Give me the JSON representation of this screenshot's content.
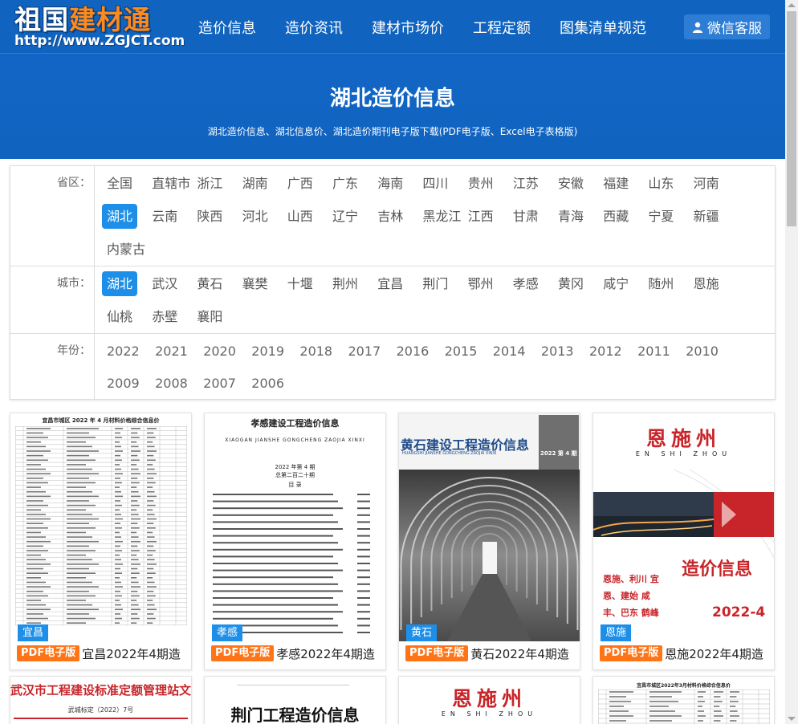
{
  "logo": {
    "text_white": "祖国",
    "text_orange": "建材通",
    "url": "http://www.ZGJCT.com"
  },
  "nav": {
    "items": [
      "造价信息",
      "造价资讯",
      "建材市场价",
      "工程定额",
      "图集清单规范"
    ],
    "wechat": "微信客服"
  },
  "hero": {
    "title": "湖北造价信息",
    "subtitle": "湖北造价信息、湖北信息价、湖北造价期刊电子版下载(PDF电子版、Excel电子表格版)"
  },
  "filter": {
    "province_label": "省区：",
    "provinces": [
      "全国",
      "直辖市",
      "浙江",
      "湖南",
      "广西",
      "广东",
      "海南",
      "四川",
      "贵州",
      "江苏",
      "安徽",
      "福建",
      "山东",
      "河南",
      "湖北",
      "云南",
      "陕西",
      "河北",
      "山西",
      "辽宁",
      "吉林",
      "黑龙江",
      "江西",
      "甘肃",
      "青海",
      "西藏",
      "宁夏",
      "新疆",
      "内蒙古"
    ],
    "province_active": "湖北",
    "city_label": "城市：",
    "cities": [
      "湖北",
      "武汉",
      "黄石",
      "襄樊",
      "十堰",
      "荆州",
      "宜昌",
      "荆门",
      "鄂州",
      "孝感",
      "黄冈",
      "咸宁",
      "随州",
      "恩施",
      "仙桃",
      "赤壁",
      "襄阳"
    ],
    "city_active": "湖北",
    "year_label": "年份：",
    "years": [
      "2022",
      "2021",
      "2020",
      "2019",
      "2018",
      "2017",
      "2016",
      "2015",
      "2014",
      "2013",
      "2012",
      "2011",
      "2010",
      "2009",
      "2008",
      "2007",
      "2006"
    ]
  },
  "cards": [
    {
      "city": "宜昌",
      "badge": "PDF电子版",
      "title": "宜昌2022年4期造",
      "doc_header": "宜昌市城区 2022 年 4 月材料价格综合信息价"
    },
    {
      "city": "孝感",
      "badge": "PDF电子版",
      "title": "孝感2022年4期造",
      "doc_header": "孝感建设工程造价信息",
      "doc_pinyin": "XIAOGAN JIANSHE GONGCHENG ZAOJIA XINXI",
      "doc_issue": "2022 年第 4 期",
      "doc_total": "总第二百二十期",
      "doc_toc": "目 录"
    },
    {
      "city": "黄石",
      "badge": "PDF电子版",
      "title": "黄石2022年4期造",
      "doc_header": "黄石建设工程造价信息",
      "doc_pinyin": "HUANGSHI JIANSHE GONGCHENG ZAOJIA XINXI",
      "doc_issue": "2022 第 4 期"
    },
    {
      "city": "恩施",
      "badge": "PDF电子版",
      "title": "恩施2022年4期造",
      "doc_header": "恩施州",
      "doc_pinyin": "EN SHI ZHOU",
      "doc_title2": "造价信息",
      "doc_issue": "2022-4",
      "doc_cities": "恩施、利川 宜恩、建始 咸丰、巴东 鹤峰"
    }
  ],
  "cards_row2": [
    {
      "doc_header": "武汉市工程建设标准定额管理站文件",
      "doc_sub": "武城标定（2022）7号"
    },
    {
      "doc_header": "荆门工程造价信息"
    },
    {
      "doc_header": "恩施州",
      "doc_pinyin": "EN SHI ZHOU"
    },
    {
      "doc_header": "宜昌市城区2022年3月材料价格综合信息价"
    }
  ],
  "colors": {
    "header_blue": "#1064bf",
    "active_blue": "#1e8fe8",
    "pdf_orange": "#ff7417",
    "logo_orange": "#ff8a1c",
    "enshi_red": "#c8252a"
  }
}
